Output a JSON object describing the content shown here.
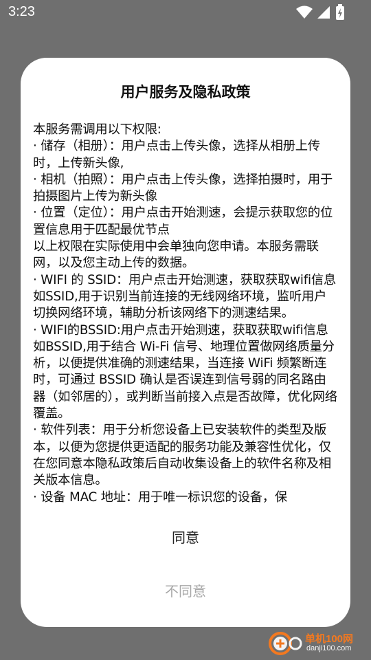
{
  "status_bar": {
    "time": "3:23",
    "icons": [
      "wifi-icon",
      "cellular-signal-icon",
      "battery-charging-icon"
    ]
  },
  "dialog": {
    "title": "用户服务及隐私政策",
    "paragraphs": [
      "本服务需调用以下权限:",
      "· 储存（相册）：用户点击上传头像，选择从相册上传时，上传新头像,",
      "· 相机（拍照）：用户点击上传头像，选择拍摄时，用于拍摄图片上传为新头像",
      "· 位置（定位）：用户点击开始测速，会提示获取您的位置信息用于匹配最优节点",
      "以上权限在实际使用中会单独向您申请。本服务需联网，以及您主动上传的数据。",
      "· WIFI 的 SSID：用户点击开始测速，获取获取wifi信息如SSID,用于识别当前连接的无线网络环境，监听用户切换网络环境，辅助分析该网络下的测速结果。",
      "· WIFI的BSSID:用户点击开始测速，获取获取wifi信息如BSSID,用于结合 Wi-Fi 信号、地理位置做网络质量分析，以便提供准确的测速结果，当连接 WiFi 频繁断连时，可通过 BSSID 确认是否误连到信号弱的同名路由器（如邻居的），或判断当前接入点是否故障，优化网络覆盖。",
      "· 软件列表：用于分析您设备上已安装软件的类型及版本，以便为您提供更适配的服务功能及兼容性优化，仅在您同意本隐私政策后自动收集设备上的软件名称及相关版本信息。",
      "· 设备 MAC 地址：用于唯一标识您的设备，保"
    ],
    "agree_label": "同意",
    "disagree_label": "不同意"
  },
  "watermark": {
    "brand": "单机100网",
    "url": "danji100.com",
    "accent_color": "#ff7a1a"
  }
}
